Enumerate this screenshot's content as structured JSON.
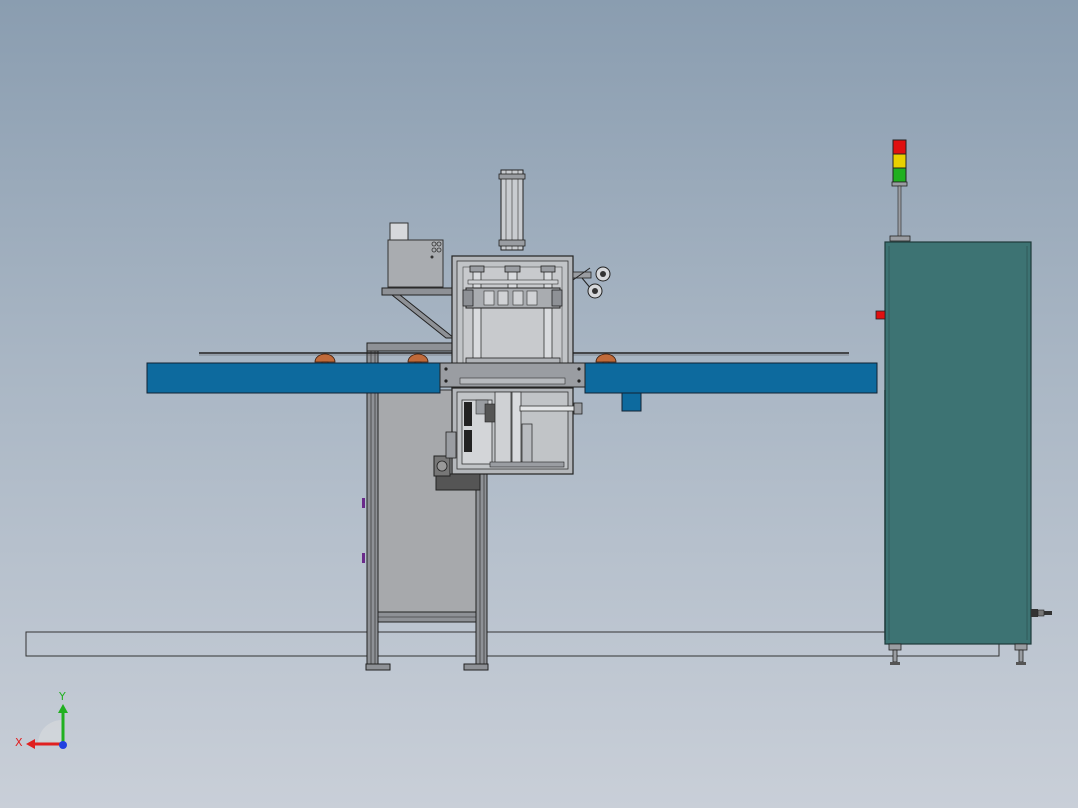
{
  "triad": {
    "x_label": "X",
    "y_label": "Y",
    "x_color": "#e02020",
    "y_color": "#20b020",
    "z_color": "#2040e0"
  },
  "colors": {
    "conveyor": "#0d6a9e",
    "cabinet": "#3d7373",
    "frame_metal": "#9a9da2",
    "panel_gray": "#a4a7ab",
    "product": "#c06a3a",
    "signal_red": "#e01010",
    "signal_yellow": "#e8d000",
    "signal_green": "#20b020"
  },
  "signal_tower": {
    "lights": [
      "red",
      "yellow",
      "green"
    ]
  }
}
